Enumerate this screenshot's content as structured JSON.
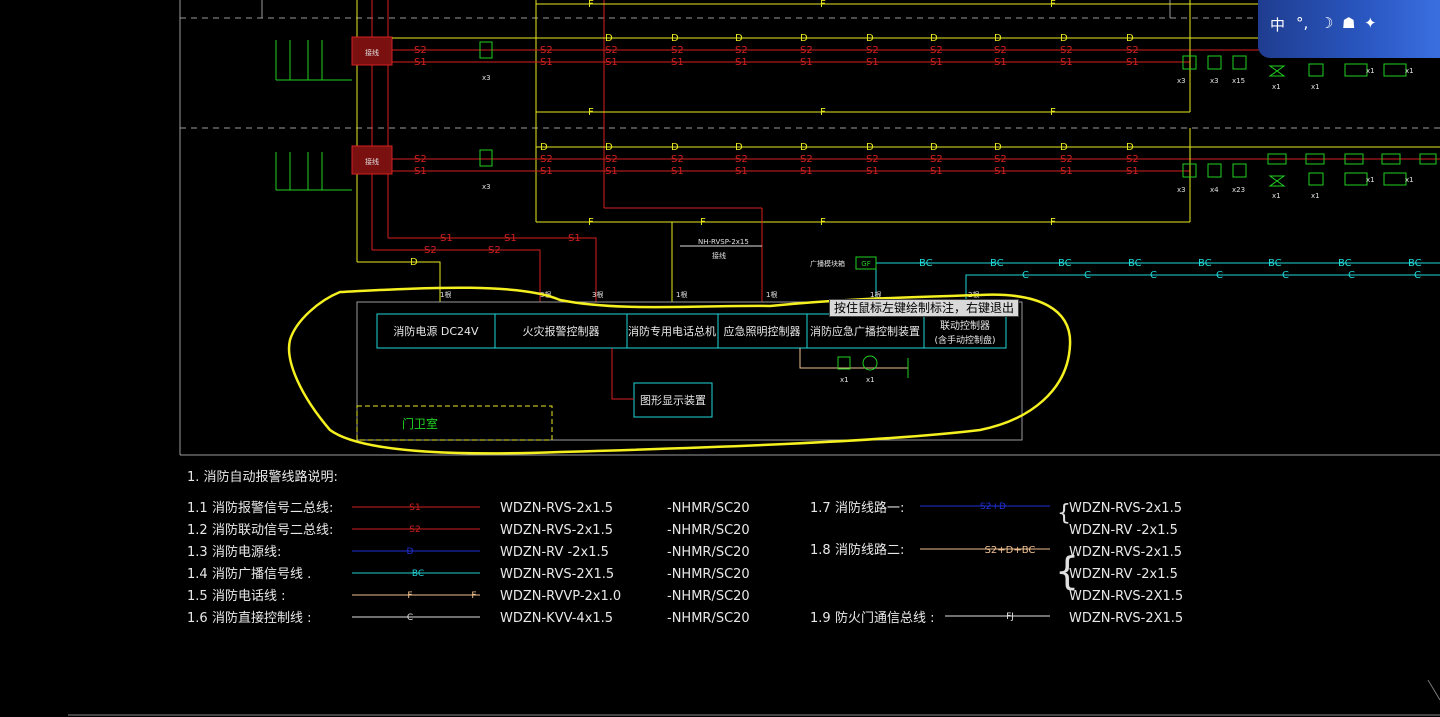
{
  "tooltip": "按住鼠标左键绘制标注，右键退出",
  "ime": {
    "lang": "中",
    "punct": "°,",
    "moon": "☽",
    "shirt": "☗",
    "star": "✦"
  },
  "equipment": {
    "power": "消防电源 DC24V",
    "alarm_controller": "火灾报警控制器",
    "phone_host": "消防专用电话总机",
    "lighting_controller": "应急照明控制器",
    "broadcast_controller": "消防应急广播控制装置",
    "linkage_line1": "联动控制器",
    "linkage_line2": "(含手动控制盘)",
    "graphic_display": "图形显示装置",
    "guard_room": "门卫室",
    "cable_label": "NH-RVSP-2x15",
    "cable_sub": "接线",
    "broadcast_module": "广播模块箱",
    "gf": "GF"
  },
  "wire_labels": {
    "s1": "S1",
    "s2": "S2",
    "d": "D",
    "f": "F",
    "bc": "BC",
    "c": "C",
    "count_1": "1根",
    "count_3": "3根",
    "count_2": "2根"
  },
  "device_counts": {
    "x1": "x1",
    "x3": "x3",
    "x4": "x4",
    "x15": "x15",
    "x23": "x23"
  },
  "legend": {
    "title": "1. 消防自动报警线路说明:",
    "rows": [
      {
        "num": "1.1",
        "name": "消防报警信号二总线:",
        "tag": "S1",
        "cable": "WDZN-RVS-2x1.5",
        "method": "-NHMR/SC20",
        "color": "#d12020"
      },
      {
        "num": "1.2",
        "name": "消防联动信号二总线:",
        "tag": "S2",
        "cable": "WDZN-RVS-2x1.5",
        "method": "-NHMR/SC20",
        "color": "#d12020"
      },
      {
        "num": "1.3",
        "name": "消防电源线:",
        "tag": "D",
        "cable": "WDZN-RV  -2x1.5",
        "method": "-NHMR/SC20",
        "color": "#2030d8"
      },
      {
        "num": "1.4",
        "name": "消防广播信号线 .",
        "tag": "BC",
        "cable": "WDZN-RVS-2X1.5",
        "method": "-NHMR/SC20",
        "color": "#20d0d0"
      },
      {
        "num": "1.5",
        "name": "消防电话线 :",
        "tag": "F",
        "cable": "WDZN-RVVP-2x1.0",
        "method": "-NHMR/SC20",
        "color": "#f0c090"
      },
      {
        "num": "1.6",
        "name": "消防直接控制线 :",
        "tag": "C",
        "cable": "WDZN-KVV-4x1.5",
        "method": "-NHMR/SC20",
        "color": "#e0e0e0"
      }
    ],
    "right_rows": [
      {
        "num": "1.7",
        "name": "消防线路一:",
        "tag": "S2+D",
        "cables": [
          "WDZN-RVS-2x1.5",
          "WDZN-RV  -2x1.5"
        ],
        "color": "#2030d8"
      },
      {
        "num": "1.8",
        "name": "消防线路二:",
        "tag": "S2+D+BC",
        "cables": [
          "WDZN-RVS-2x1.5",
          "WDZN-RV  -2x1.5",
          "WDZN-RVS-2X1.5"
        ],
        "color": "#f0c090"
      },
      {
        "num": "1.9",
        "name": "防火门通信总线 :",
        "tag": "FJ",
        "cables": [
          "WDZN-RVS-2X1.5"
        ],
        "color": "#e0e0e0"
      }
    ]
  },
  "colors": {
    "red": "#d42020",
    "yellow": "#e8e820",
    "green": "#20d020",
    "cyan": "#20d8d8",
    "white": "#e0e0e0",
    "blue": "#2030d8",
    "highlight": "#f5f020"
  }
}
